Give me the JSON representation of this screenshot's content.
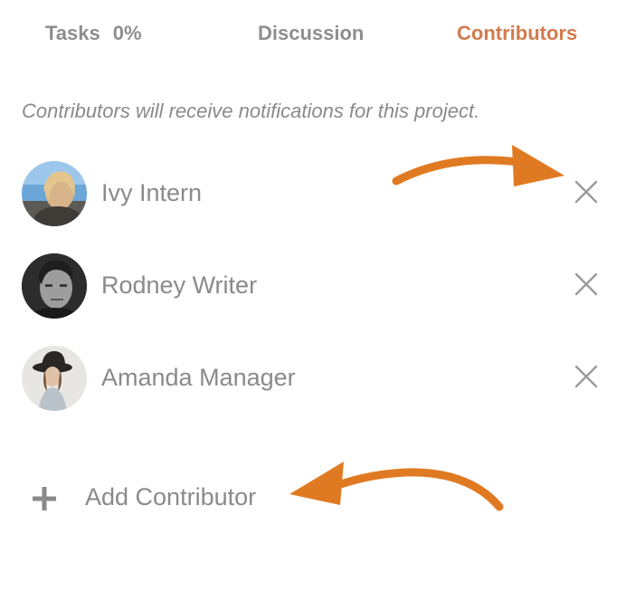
{
  "tabs": {
    "tasks_label": "Tasks",
    "tasks_percent": "0%",
    "discussion_label": "Discussion",
    "contributors_label": "Contributors",
    "active": "Contributors"
  },
  "note": "Contributors will receive notifications for this project.",
  "contributors": [
    {
      "name": "Ivy Intern",
      "avatar": "avatar-ivy"
    },
    {
      "name": "Rodney Writer",
      "avatar": "avatar-rodney"
    },
    {
      "name": "Amanda Manager",
      "avatar": "avatar-amanda"
    }
  ],
  "add_contributor": {
    "label": "Add Contributor",
    "icon": "plus-icon"
  },
  "colors": {
    "accent": "#d27a4c",
    "annotation_arrow": "#e07a22",
    "text_muted": "#8a8a8a",
    "remove_icon": "#9a9a9a"
  }
}
